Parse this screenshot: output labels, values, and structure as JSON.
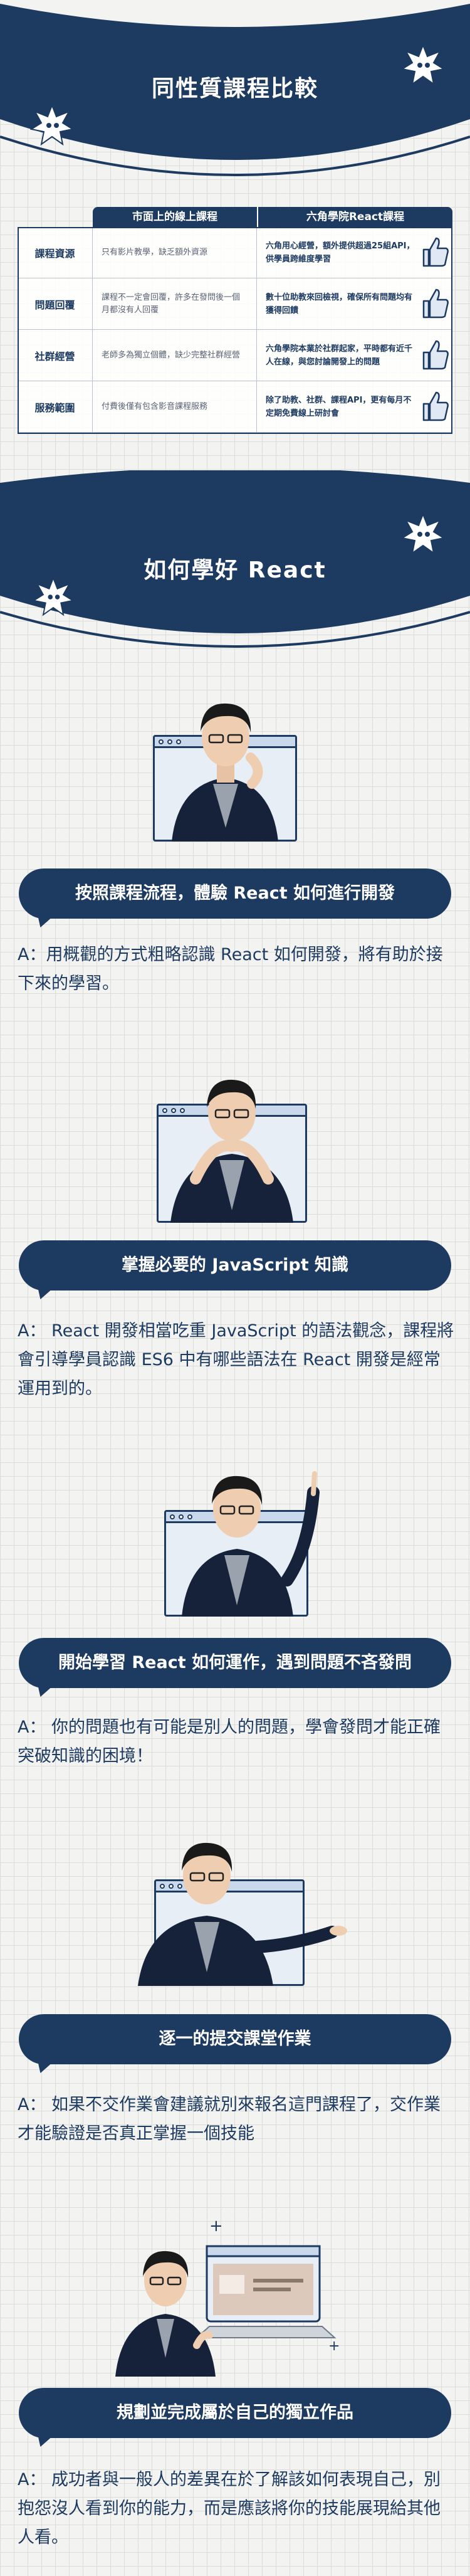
{
  "hero1": {
    "title": "同性質課程比較"
  },
  "compare": {
    "headers": [
      "市面上的線上課程",
      "六角學院React課程"
    ],
    "rows": [
      {
        "label": "課程資源",
        "market": "只有影片教學，缺乏額外資源",
        "hexschool": "六角用心經營，額外提供超過25組API，供學員跨維度學習"
      },
      {
        "label": "問題回覆",
        "market": "課程不一定會回覆，許多在發問後一個月都沒有人回覆",
        "hexschool": "數十位助教來回檢視，確保所有問題均有獲得回饋"
      },
      {
        "label": "社群經營",
        "market": "老師多為獨立個體，缺少完整社群經營",
        "hexschool": "六角學院本業於社群起家，平時都有近千人在線，與您討論開發上的問題"
      },
      {
        "label": "服務範圍",
        "market": "付費後僅有包含影音課程服務",
        "hexschool": "除了助教、社群、課程API，更有每月不定期免費線上研討會"
      }
    ],
    "thumb_icon": "thumbs-up-icon"
  },
  "hero2": {
    "title": "如何學好 React"
  },
  "steps": [
    {
      "heading": "按照課程流程，體驗 React 如何進行開發",
      "answer": "A：用概觀的方式粗略認識 React 如何開發，將有助於接下來的學習。"
    },
    {
      "heading": "掌握必要的 JavaScript 知識",
      "answer": "A： React 開發相當吃重 JavaScript 的語法觀念，課程將會引導學員認識 ES6 中有哪些語法在 React 開發是經常運用到的。"
    },
    {
      "heading": "開始學習 React 如何運作，遇到問題不吝發問",
      "answer": "A： 你的問題也有可能是別人的問題，學會發問才能正確突破知識的困境！"
    },
    {
      "heading": "逐一的提交課堂作業",
      "answer": "A： 如果不交作業會建議就別來報名這門課程了，交作業才能驗證是否真正掌握一個技能"
    },
    {
      "heading": "規劃並完成屬於自己的獨立作品",
      "answer": "A： 成功者與一般人的差異在於了解該如何表現自己，別抱怨沒人看到你的能力，而是應該將你的技能展現給其他人看。"
    }
  ],
  "colors": {
    "navy": "#1d3a60",
    "background": "#f3f3f1",
    "shirt": "#9aa3ad"
  }
}
